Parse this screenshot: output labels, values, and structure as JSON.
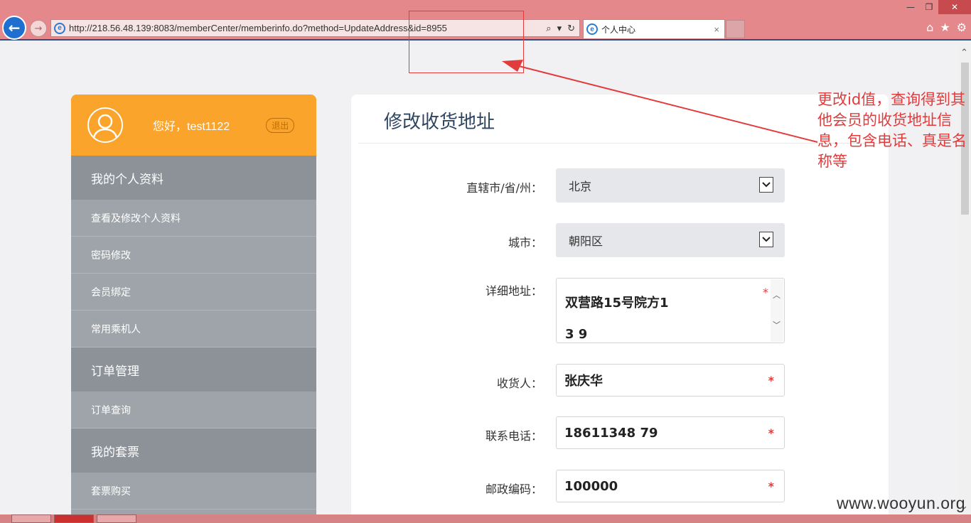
{
  "browser": {
    "url": "http://218.56.48.139:8083/memberCenter/memberinfo.do?method=UpdateAddress&id=8955",
    "tab_title": "个人中心",
    "tab_close": "×",
    "back_glyph": "←",
    "forward_glyph": "→",
    "search_glyph": "⌕",
    "dropdown_glyph": "▾",
    "refresh_glyph": "↻",
    "min_glyph": "—",
    "restore_glyph": "❐",
    "close_glyph": "✕",
    "home_glyph": "⌂",
    "fav_glyph": "★",
    "settings_glyph": "⚙"
  },
  "annotation": {
    "text": "更改id值，查询得到其他会员的收货地址信息，包含电话、真是名称等",
    "color": "#e23b3b"
  },
  "sidebar": {
    "greeting": "您好，test1122",
    "logout_label": "退出",
    "sections": [
      {
        "title": "我的个人资料",
        "items": [
          "查看及修改个人资料",
          "密码修改",
          "会员绑定",
          "常用乘机人"
        ]
      },
      {
        "title": "订单管理",
        "items": [
          "订单查询"
        ]
      },
      {
        "title": "我的套票",
        "items": [
          "套票购买"
        ]
      }
    ],
    "accent": "#fba42b"
  },
  "form": {
    "title": "修改收货地址",
    "province_label": "直辖市/省/州：",
    "province_value": "北京",
    "city_label": "城市：",
    "city_value": "朝阳区",
    "address_label": "详细地址：",
    "address_line1": "双营路15号院方1",
    "address_line2": "3 9",
    "receiver_label": "收货人：",
    "receiver_value": "张庆华",
    "phone_label": "联系电话：",
    "phone_value": "18611348 79",
    "zip_label": "邮政编码：",
    "zip_value": "100000",
    "required_mark": "*"
  },
  "watermark": "www.wooyun.org"
}
